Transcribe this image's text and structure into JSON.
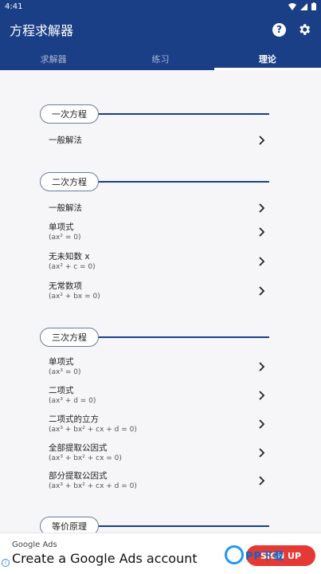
{
  "status": {
    "time": "4:41"
  },
  "app": {
    "title": "方程求解器"
  },
  "tabs": [
    {
      "label": "求解器"
    },
    {
      "label": "练习"
    },
    {
      "label": "理论"
    }
  ],
  "sections": [
    {
      "title": "一次方程",
      "items": [
        {
          "title": "一般解法",
          "sub": ""
        }
      ]
    },
    {
      "title": "二次方程",
      "items": [
        {
          "title": "一般解法",
          "sub": ""
        },
        {
          "title": "单项式",
          "sub": "(ax² = 0)"
        },
        {
          "title": "无未知数 x",
          "sub": "(ax² + c = 0)"
        },
        {
          "title": "无常数项",
          "sub": "(ax² + bx = 0)"
        }
      ]
    },
    {
      "title": "三次方程",
      "items": [
        {
          "title": "单项式",
          "sub": "(ax³ = 0)"
        },
        {
          "title": "二项式",
          "sub": "(ax³ + d = 0)"
        },
        {
          "title": "二项式的立方",
          "sub": "(ax³ + bx² + cx + d = 0)"
        },
        {
          "title": "全部提取公因式",
          "sub": "(ax³ + bx² + cx = 0)"
        },
        {
          "title": "部分提取公因式",
          "sub": "(ax³ + bx² + cx + d = 0)"
        }
      ]
    },
    {
      "title": "等价原理",
      "items": []
    }
  ],
  "ad": {
    "label": "Google Ads",
    "headline": "Create a Google Ads account",
    "button": "SIGN UP"
  },
  "watermark": {
    "text": "PP下载"
  },
  "icons": {
    "help": "help-icon",
    "settings": "gear-icon",
    "chevron": "chevron-right-icon",
    "info": "ad-info-icon"
  },
  "colors": {
    "primary": "#1b3f86",
    "background": "#f6f6f8",
    "ad_button": "#e53935"
  }
}
